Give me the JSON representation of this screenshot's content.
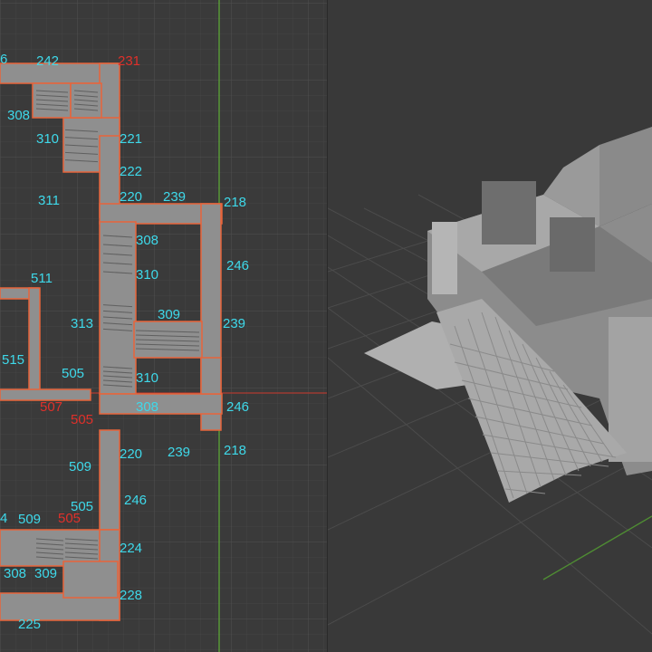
{
  "colors": {
    "background": "#3a3a3a",
    "grid_minor": "#444444",
    "grid_major": "#4f4f4f",
    "axis_green": "#5fae36",
    "axis_red": "#b03a30",
    "tile_fill": "#8f8f8f",
    "tile_outline": "#e8643a",
    "label_cyan": "#3ed9ea",
    "label_red": "#e0302a",
    "model_gray": "#9c9c9c"
  },
  "plan": {
    "labels": [
      {
        "text": "6",
        "color": "cyan"
      },
      {
        "text": "242",
        "color": "cyan"
      },
      {
        "text": "231",
        "color": "red"
      },
      {
        "text": "308",
        "color": "cyan"
      },
      {
        "text": "310",
        "color": "cyan"
      },
      {
        "text": "221",
        "color": "cyan"
      },
      {
        "text": "222",
        "color": "cyan"
      },
      {
        "text": "311",
        "color": "cyan"
      },
      {
        "text": "220",
        "color": "cyan"
      },
      {
        "text": "239",
        "color": "cyan"
      },
      {
        "text": "218",
        "color": "cyan"
      },
      {
        "text": "308",
        "color": "cyan"
      },
      {
        "text": "246",
        "color": "cyan"
      },
      {
        "text": "511",
        "color": "cyan"
      },
      {
        "text": "310",
        "color": "cyan"
      },
      {
        "text": "313",
        "color": "cyan"
      },
      {
        "text": "309",
        "color": "cyan"
      },
      {
        "text": "239",
        "color": "cyan"
      },
      {
        "text": "515",
        "color": "cyan"
      },
      {
        "text": "505",
        "color": "cyan"
      },
      {
        "text": "310",
        "color": "cyan"
      },
      {
        "text": "507",
        "color": "red"
      },
      {
        "text": "308",
        "color": "cyan"
      },
      {
        "text": "246",
        "color": "cyan"
      },
      {
        "text": "505",
        "color": "red"
      },
      {
        "text": "220",
        "color": "cyan"
      },
      {
        "text": "239",
        "color": "cyan"
      },
      {
        "text": "218",
        "color": "cyan"
      },
      {
        "text": "509",
        "color": "cyan"
      },
      {
        "text": "246",
        "color": "cyan"
      },
      {
        "text": "505",
        "color": "cyan"
      },
      {
        "text": "4",
        "color": "cyan"
      },
      {
        "text": "509",
        "color": "cyan"
      },
      {
        "text": "505",
        "color": "red"
      },
      {
        "text": "224",
        "color": "cyan"
      },
      {
        "text": "308",
        "color": "cyan"
      },
      {
        "text": "309",
        "color": "cyan"
      },
      {
        "text": "228",
        "color": "cyan"
      },
      {
        "text": "225",
        "color": "cyan"
      }
    ]
  }
}
